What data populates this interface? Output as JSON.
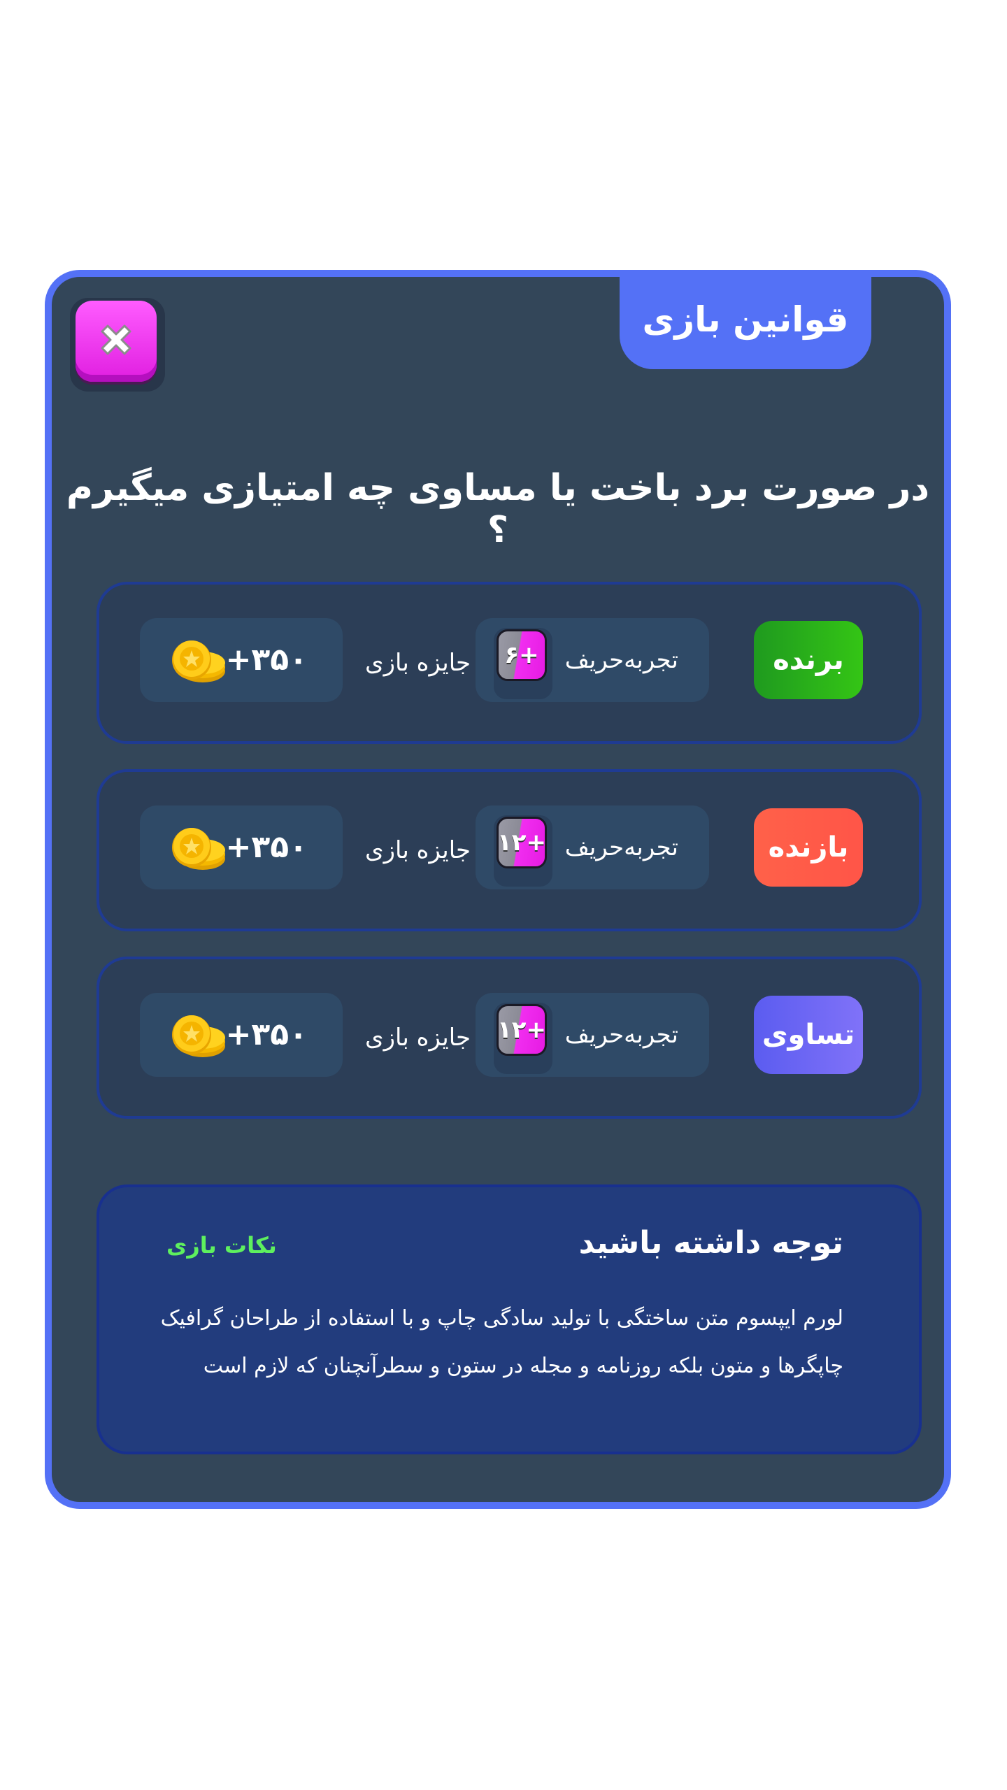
{
  "dialog": {
    "tab_title": "قوانین بازی",
    "question": "در صورت برد باخت یا مساوی چه امتیازی میگیرم ؟"
  },
  "rows": [
    {
      "badge": "برنده",
      "badge_colors": [
        "#1f9a1f",
        "#34c515"
      ],
      "xp_label": "تجربه‌حریف",
      "xp_value": "+۶",
      "prize_label": "جایزه بازی",
      "coin_value": "+۳۵۰"
    },
    {
      "badge": "بازنده",
      "badge_colors": [
        "#ff6149",
        "#ff5548"
      ],
      "xp_label": "تجربه‌حریف",
      "xp_value": "+۱۲",
      "prize_label": "جایزه بازی",
      "coin_value": "+۳۵۰"
    },
    {
      "badge": "تساوی",
      "badge_colors": [
        "#5b5cf0",
        "#8072f8"
      ],
      "xp_label": "تجربه‌حریف",
      "xp_value": "+۱۲",
      "prize_label": "جایزه بازی",
      "coin_value": "+۳۵۰"
    }
  ],
  "note": {
    "title": "توجه داشته باشید",
    "tag": "نکات بازی",
    "body": "لورم ایپسوم متن ساختگی با تولید سادگی چاپ و با استفاده از طراحان گرافیک چاپگرها و متون بلکه روزنامه و مجله در ستون و سطرآنچنان که لازم است"
  },
  "colors": {
    "accent": "#5471f6",
    "card_bg": "#334659",
    "close_button": "#ff40ff",
    "tag_green": "#5ef05e"
  },
  "icons": {
    "close": "close-icon",
    "xp": "xp-icon",
    "coins": "coin-stack-icon"
  }
}
